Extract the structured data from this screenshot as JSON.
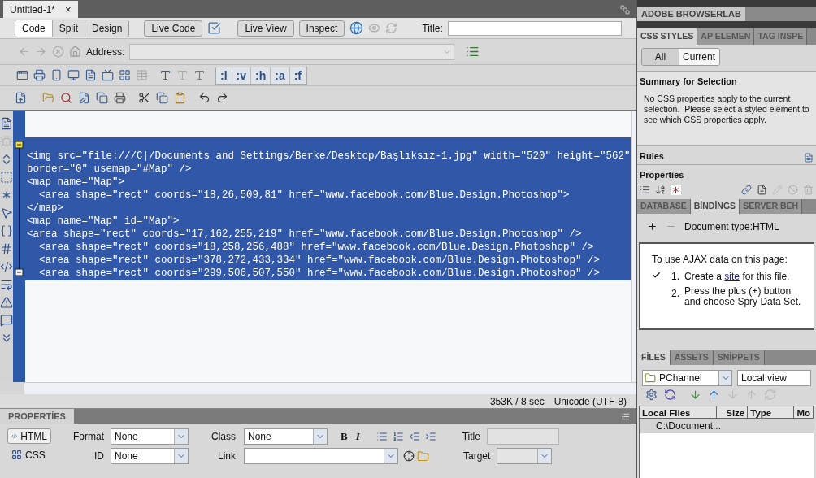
{
  "document_tab": {
    "title": "Untitled-1*",
    "close": "×"
  },
  "view_buttons": [
    {
      "label": "Code",
      "selected": true
    },
    {
      "label": "Split",
      "selected": false
    },
    {
      "label": "Design",
      "selected": false
    }
  ],
  "live_code": "Live Code",
  "live_view": "Live View",
  "inspect": "Inspect",
  "title_label": "Title:",
  "address_label": "Address:",
  "style_buttons": [
    ":l",
    ":v",
    ":h",
    ":a",
    ":f"
  ],
  "code_lines": [
    "<img src=\"file:///C|/Documents and Settings/Berke/Desktop/Başlıksız-1.jpg\" width=\"520\" height=\"562\"",
    "border=\"0\" usemap=\"#Map\" />",
    "<map name=\"Map\">",
    "  <area shape=\"rect\" coords=\"18,26,509,81\" href=\"www.facebook.com/Blue.Design.Photoshop\">",
    "</map>",
    "<map name=\"Map\" id=\"Map\">",
    "<area shape=\"rect\" coords=\"17,162,255,219\" href=\"www.facebook.com/Blue.Design.Photoshop\" />",
    "  <area shape=\"rect\" coords=\"18,258,256,488\" href=\"www.facebook.com/Blue.Design.Photoshop\" />",
    "  <area shape=\"rect\" coords=\"378,272,433,334\" href=\"www.facebook.com/Blue.Design.Photoshop\" />",
    "  <area shape=\"rect\" coords=\"299,506,507,550\" href=\"www.facebook.com/Blue.Design.Photoshop\" />"
  ],
  "status": {
    "size": "353K / 8 sec",
    "encoding": "Unicode (UTF-8)"
  },
  "properties": {
    "title": "PROPERTİES",
    "modes": [
      {
        "label": "HTML",
        "selected": true
      },
      {
        "label": "CSS",
        "selected": false
      }
    ],
    "format_label": "Format",
    "format": "None",
    "id_label": "ID",
    "id": "None",
    "class_label": "Class",
    "class": "None",
    "link_label": "Link",
    "bold": "B",
    "italic": "I",
    "title_label": "Title",
    "target_label": "Target"
  },
  "browserlab": "ADOBE BROWSERLAB",
  "css_tabs": [
    {
      "label": "CSS STYLES",
      "selected": true
    },
    {
      "label": "AP ELEMEN",
      "selected": false
    },
    {
      "label": "TAG INSPE",
      "selected": false
    }
  ],
  "css_modes": [
    {
      "label": "All",
      "selected": false
    },
    {
      "label": "Current",
      "selected": true
    }
  ],
  "summary_title": "Summary for Selection",
  "summary_text": "No CSS properties apply to the current selection.  Please select a styled element to see which CSS properties apply.",
  "rules": "Rules",
  "properties_title": "Properties",
  "data_tabs": [
    {
      "label": "DATABASE",
      "selected": false
    },
    {
      "label": "BİNDİNGS",
      "selected": true
    },
    {
      "label": "SERVER BEH",
      "selected": false
    }
  ],
  "doc_type": "Document type:HTML",
  "ajax": {
    "intro": "To use AJAX data on this page:",
    "steps": [
      {
        "kind": "link",
        "number": "1.",
        "before": "Create a ",
        "link": "site",
        "after": " for this file.",
        "checked": true
      },
      {
        "kind": "plain",
        "number": "2.",
        "text": "Press the plus (+) button and choose Spry Data Set.",
        "checked": false
      }
    ]
  },
  "files_tabs": [
    {
      "label": "FİLES",
      "selected": true
    },
    {
      "label": "ASSETS",
      "selected": false
    },
    {
      "label": "SNİPPETS",
      "selected": false
    }
  ],
  "site": "PChannel",
  "view": "Local view",
  "files_columns": [
    "Local Files",
    "Size",
    "Type",
    "Mo"
  ],
  "files_rows": [
    {
      "name": "C:\\Document...",
      "selected": true
    }
  ]
}
